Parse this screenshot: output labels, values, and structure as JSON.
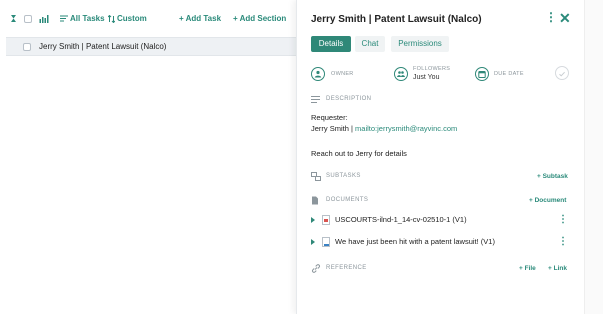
{
  "toolbar": {
    "all_tasks_label": "All Tasks",
    "custom_label": "Custom",
    "add_task_label": "+ Add Task",
    "add_section_label": "+ Add Section"
  },
  "task_list": {
    "rows": [
      {
        "title": "Jerry Smith | Patent Lawsuit (Nalco)"
      }
    ]
  },
  "detail": {
    "title": "Jerry Smith | Patent Lawsuit (Nalco)",
    "tabs": [
      {
        "label": "Details",
        "active": true
      },
      {
        "label": "Chat",
        "active": false
      },
      {
        "label": "Permissions",
        "active": false
      }
    ],
    "meta": {
      "owner_label": "OWNER",
      "followers_label": "FOLLOWERS",
      "followers_value": "Just You",
      "due_date_label": "DUE DATE"
    },
    "description": {
      "label": "DESCRIPTION",
      "line1": "Requester:",
      "line2_name": "Jerry Smith | ",
      "line2_link": "mailto:jerrysmith@rayvinc.com",
      "line3": "Reach out to Jerry for details"
    },
    "subtasks": {
      "label": "SUBTASKS",
      "add_label": "+ Subtask"
    },
    "documents": {
      "label": "DOCUMENTS",
      "add_label": "+ Document",
      "items": [
        {
          "name": "USCOURTS-ilnd-1_14-cv-02510-1 (V1)",
          "icon": "pdf-file-icon"
        },
        {
          "name": "We have just been hit with a patent lawsuit! (V1)",
          "icon": "doc-file-icon"
        }
      ]
    },
    "reference": {
      "label": "REFERENCE",
      "add_file_label": "+ File",
      "add_link_label": "+ Link"
    }
  },
  "colors": {
    "accent": "#2a8a7a",
    "accent_dark": "#2f8878",
    "muted": "#8c969c",
    "row_bg": "#eef1f4"
  }
}
